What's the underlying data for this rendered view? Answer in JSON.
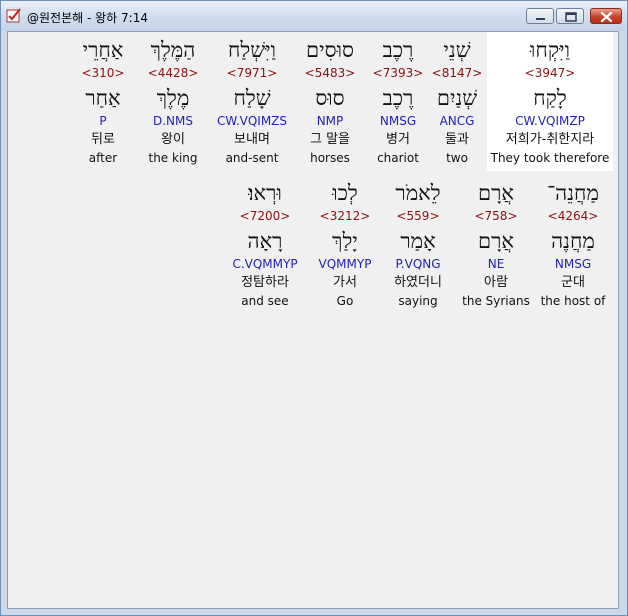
{
  "window": {
    "title": "@원전본해 - 왕하 7:14",
    "app_icon": "checkmark-app-icon",
    "controls": [
      "minimize-icon",
      "maximize-icon",
      "close-icon"
    ]
  },
  "colors": {
    "strong": "#8b1010",
    "morph": "#2222b2",
    "selected_bg": "#ffffff",
    "client_bg": "#f0f0f0"
  },
  "rows": [
    {
      "words": [
        {
          "hebrew": "וַיִּקְחוּ",
          "strong": "<3947>",
          "lemma": "לָקַח",
          "morph": "CW.VQIMZP",
          "korean": "저희가-취한지라",
          "english": "They took therefore",
          "selected": true
        },
        {
          "hebrew": "שְׁנֵי",
          "strong": "<8147>",
          "lemma": "שְׁנַיִם",
          "morph": "ANCG",
          "korean": "둘과",
          "english": "two"
        },
        {
          "hebrew": "רֶכֶב",
          "strong": "<7393>",
          "lemma": "רֶכֶב",
          "morph": "NMSG",
          "korean": "병거",
          "english": "chariot"
        },
        {
          "hebrew": "סוּסִים",
          "strong": "<5483>",
          "lemma": "סוּס",
          "morph": "NMP",
          "korean": "그 말을",
          "english": "horses"
        },
        {
          "hebrew": "וַיִּשְׁלַח",
          "strong": "<7971>",
          "lemma": "שָׁלַח",
          "morph": "CW.VQIMZS",
          "korean": "보내며",
          "english": "and-sent"
        },
        {
          "hebrew": "הַמֶּלֶךְ",
          "strong": "<4428>",
          "lemma": "מֶלֶךְ",
          "morph": "D.NMS",
          "korean": "왕이",
          "english": "the king"
        },
        {
          "hebrew": "אַחֲרֵי",
          "strong": "<310>",
          "lemma": "אַחַר",
          "morph": "P",
          "korean": "뒤로",
          "english": "after"
        }
      ]
    },
    {
      "words": [
        {
          "hebrew": "מַחֲנֵה־",
          "strong": "<4264>",
          "lemma": "מַחֲנֶה",
          "morph": "NMSG",
          "korean": "군대",
          "english": "the host of"
        },
        {
          "hebrew": "אֲרָם",
          "strong": "<758>",
          "lemma": "אֲרָם",
          "morph": "NE",
          "korean": "아람",
          "english": "the Syrians"
        },
        {
          "hebrew": "לֵאמֹר",
          "strong": "<559>",
          "lemma": "אָמַר",
          "morph": "P.VQNG",
          "korean": "하였더니",
          "english": "saying"
        },
        {
          "hebrew": "לְכוּ",
          "strong": "<3212>",
          "lemma": "יָלַךְ",
          "morph": "VQMMYP",
          "korean": "가서",
          "english": "Go"
        },
        {
          "hebrew": "וּרְאוּ׃",
          "strong": "<7200>",
          "lemma": "רָאָה",
          "morph": "C.VQMMYP",
          "korean": "정탐하라",
          "english": "and see"
        }
      ]
    }
  ]
}
